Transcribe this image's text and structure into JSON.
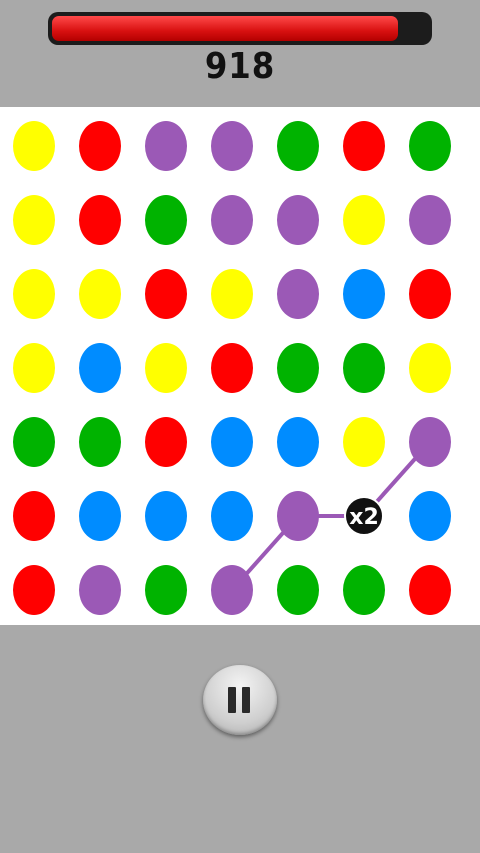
{
  "hud": {
    "score": "918",
    "timer_fraction": 0.92,
    "timer_color": "#e01a1a"
  },
  "colors": {
    "yellow": "#ffff00",
    "red": "#ff0000",
    "purple": "#9b59b6",
    "green": "#00b300",
    "blue": "#008cff"
  },
  "board": {
    "rows": 7,
    "cols": 7,
    "grid": [
      [
        "yellow",
        "red",
        "purple",
        "purple",
        "green",
        "red",
        "green"
      ],
      [
        "yellow",
        "red",
        "green",
        "purple",
        "purple",
        "yellow",
        "purple"
      ],
      [
        "yellow",
        "yellow",
        "red",
        "yellow",
        "purple",
        "blue",
        "red"
      ],
      [
        "yellow",
        "blue",
        "yellow",
        "red",
        "green",
        "green",
        "yellow"
      ],
      [
        "green",
        "green",
        "red",
        "blue",
        "blue",
        "yellow",
        "purple"
      ],
      [
        "red",
        "blue",
        "blue",
        "blue",
        "purple",
        "multiplier",
        "blue"
      ],
      [
        "red",
        "purple",
        "green",
        "purple",
        "green",
        "green",
        "red"
      ]
    ],
    "multiplier_label": "x2",
    "selected_path_color": "purple",
    "selected_path": [
      [
        6,
        3
      ],
      [
        5,
        4
      ],
      [
        5,
        5
      ],
      [
        4,
        6
      ]
    ]
  },
  "controls": {
    "pause_icon": "pause-icon"
  }
}
